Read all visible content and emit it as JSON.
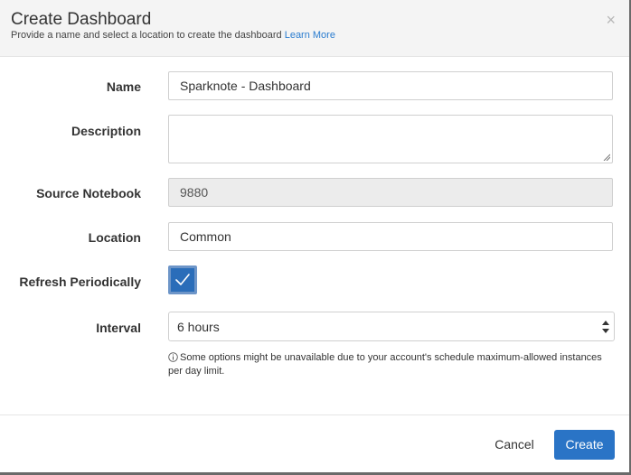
{
  "dialog": {
    "title": "Create Dashboard",
    "subtitle": "Provide a name and select a location to create the dashboard",
    "learn_more": "Learn More",
    "close": "×"
  },
  "form": {
    "name": {
      "label": "Name",
      "value": "Sparknote - Dashboard"
    },
    "description": {
      "label": "Description",
      "value": ""
    },
    "source_notebook": {
      "label": "Source Notebook",
      "value": "9880"
    },
    "location": {
      "label": "Location",
      "value": "Common"
    },
    "refresh": {
      "label": "Refresh Periodically",
      "checked": true
    },
    "interval": {
      "label": "Interval",
      "selected": "6 hours",
      "note": "Some options might be unavailable due to your account's schedule maximum-allowed instances per day limit."
    }
  },
  "footer": {
    "cancel": "Cancel",
    "create": "Create"
  },
  "colors": {
    "primary": "#2a74c6",
    "checkbox": "#2a6db9",
    "link": "#2a7ccf",
    "readonly_bg": "#ececec"
  },
  "icons": {
    "close": "close-icon",
    "checkmark": "checkmark-icon",
    "select_arrows": "select-arrows-icon",
    "info": "info-icon",
    "resize": "resize-grip-icon"
  }
}
